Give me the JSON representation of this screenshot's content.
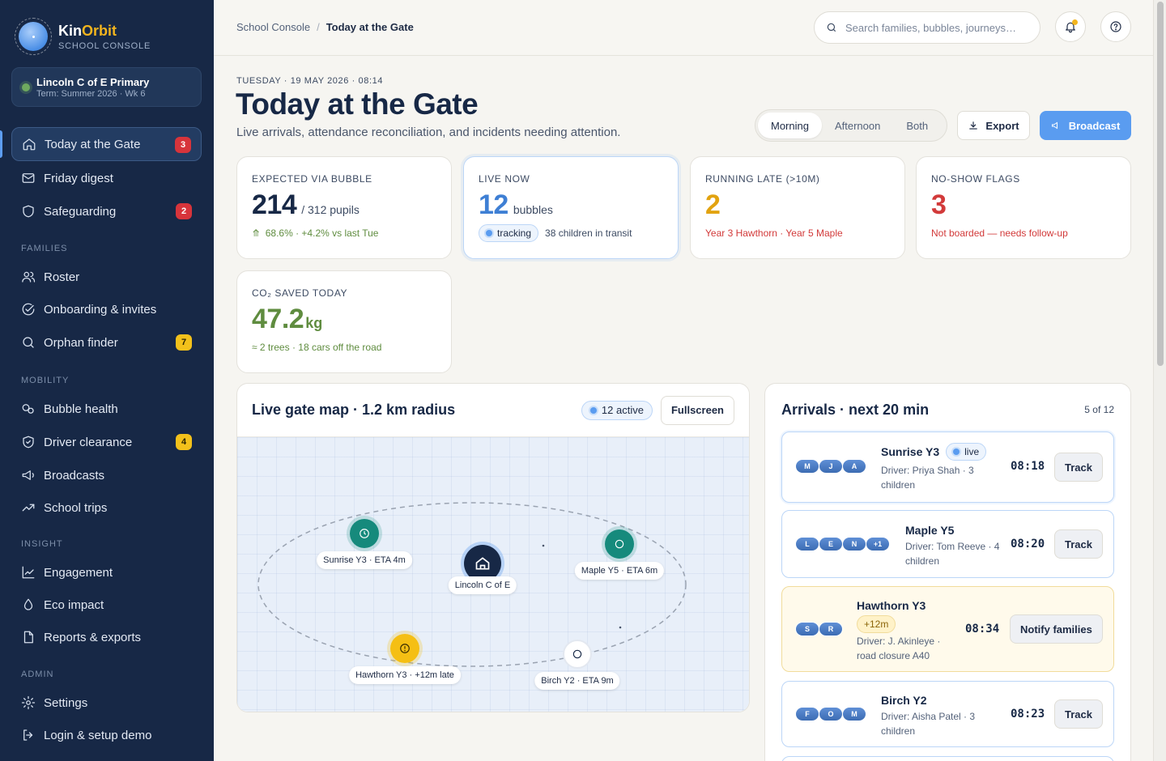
{
  "brand": {
    "name_a": "Kin",
    "name_b": "Orbit",
    "subtitle": "SCHOOL CONSOLE",
    "accent": "#f3b51e"
  },
  "school": {
    "name": "Lincoln C of E Primary",
    "term": "Term: Summer 2026 · Wk 6",
    "status_color": "#6ea95f"
  },
  "nav": {
    "primary": [
      {
        "label": "Today at the Gate",
        "icon": "home-icon",
        "badge": "3",
        "active": true
      },
      {
        "label": "Friday digest",
        "icon": "mail-icon"
      },
      {
        "label": "Safeguarding",
        "icon": "shield-icon",
        "badge": "2"
      }
    ],
    "sections": [
      {
        "title": "FAMILIES",
        "items": [
          {
            "label": "Roster",
            "icon": "users-icon"
          },
          {
            "label": "Onboarding & invites",
            "icon": "check-circle-icon"
          },
          {
            "label": "Orphan finder",
            "icon": "search-icon",
            "badge": "7"
          }
        ]
      },
      {
        "title": "MOBILITY",
        "items": [
          {
            "label": "Bubble health",
            "icon": "bubbles-icon"
          },
          {
            "label": "Driver clearance",
            "icon": "shield-check-icon",
            "badge": "4"
          },
          {
            "label": "Broadcasts",
            "icon": "megaphone-icon"
          },
          {
            "label": "School trips",
            "icon": "trend-icon"
          }
        ]
      },
      {
        "title": "INSIGHT",
        "items": [
          {
            "label": "Engagement",
            "icon": "line-chart-icon"
          },
          {
            "label": "Eco impact",
            "icon": "drop-icon"
          },
          {
            "label": "Reports & exports",
            "icon": "file-icon"
          }
        ]
      },
      {
        "title": "ADMIN",
        "items": [
          {
            "label": "Settings",
            "icon": "gear-icon"
          },
          {
            "label": "Login & setup demo",
            "icon": "logout-icon"
          }
        ]
      }
    ]
  },
  "topbar": {
    "breadcrumb": [
      "School Console",
      "Today at the Gate"
    ],
    "search_placeholder": "Search families, bubbles, journeys…"
  },
  "header": {
    "date": "TUESDAY · 19 MAY 2026 · 08:14",
    "title": "Today at the Gate",
    "subtitle": "Live arrivals, attendance reconciliation, and incidents needing attention.",
    "segments": [
      "Morning",
      "Afternoon",
      "Both"
    ],
    "active_segment": "Morning",
    "export_label": "Export",
    "broadcast_label": "Broadcast"
  },
  "stats": {
    "expected": {
      "label": "EXPECTED VIA BUBBLE",
      "value": "214",
      "unit": "/ 312 pupils",
      "note": "68.6% · +4.2% vs last Tue"
    },
    "live": {
      "label": "LIVE NOW",
      "value": "12",
      "unit": "bubbles",
      "pill": "tracking",
      "note": "38 children in transit"
    },
    "late": {
      "label": "RUNNING LATE (>10M)",
      "value": "2",
      "note": "Year 3 Hawthorn · Year 5 Maple"
    },
    "noshow": {
      "label": "NO-SHOW FLAGS",
      "value": "3",
      "note": "Not boarded — needs follow-up"
    },
    "co2": {
      "label": "CO₂ SAVED TODAY",
      "value": "47.2",
      "unit": "kg",
      "note": "≈ 2 trees · 18 cars off the road"
    }
  },
  "map": {
    "title": "Live gate map · 1.2 km radius",
    "active_pill": "12 active",
    "fullscreen_label": "Fullscreen",
    "school_label": "Lincoln C of E",
    "pins": [
      {
        "label": "Sunrise Y3 · ETA 4m",
        "status": "on-time",
        "icon": "clock-icon"
      },
      {
        "label": "Maple Y5 · ETA 6m",
        "status": "on-time",
        "icon": "circle-icon"
      },
      {
        "label": "Hawthorn Y3 · +12m late",
        "status": "late",
        "icon": "alert-icon"
      },
      {
        "label": "Birch Y2 · ETA 9m",
        "status": "pending",
        "icon": "circle-icon"
      }
    ],
    "colors": {
      "on_time": "#168a7c",
      "late": "#f5bf14",
      "school": "#172846"
    }
  },
  "arrivals": {
    "title": "Arrivals · next 20 min",
    "count": "5 of 12",
    "items": [
      {
        "name": "Sunrise Y3",
        "tag": "live",
        "avatars": [
          "M",
          "J",
          "A"
        ],
        "driver_a": "Driver: Priya Shah · 3",
        "driver_b": "children",
        "time": "08:18",
        "action": "Track"
      },
      {
        "name": "Maple Y5",
        "avatars": [
          "L",
          "E",
          "N",
          "+1"
        ],
        "driver_a": "Driver: Tom Reeve · 4",
        "driver_b": "children",
        "time": "08:20",
        "action": "Track"
      },
      {
        "name": "Hawthorn Y3",
        "late_tag": "+12m",
        "avatars": [
          "S",
          "R"
        ],
        "driver_a": "Driver: J. Akinleye ·",
        "driver_b": "road closure A40",
        "time": "08:34",
        "action": "Notify families"
      },
      {
        "name": "Birch Y2",
        "avatars": [
          "F",
          "O",
          "M"
        ],
        "driver_a": "Driver: Aisha Patel · 3",
        "driver_b": "children",
        "time": "08:23",
        "action": "Track"
      }
    ]
  }
}
